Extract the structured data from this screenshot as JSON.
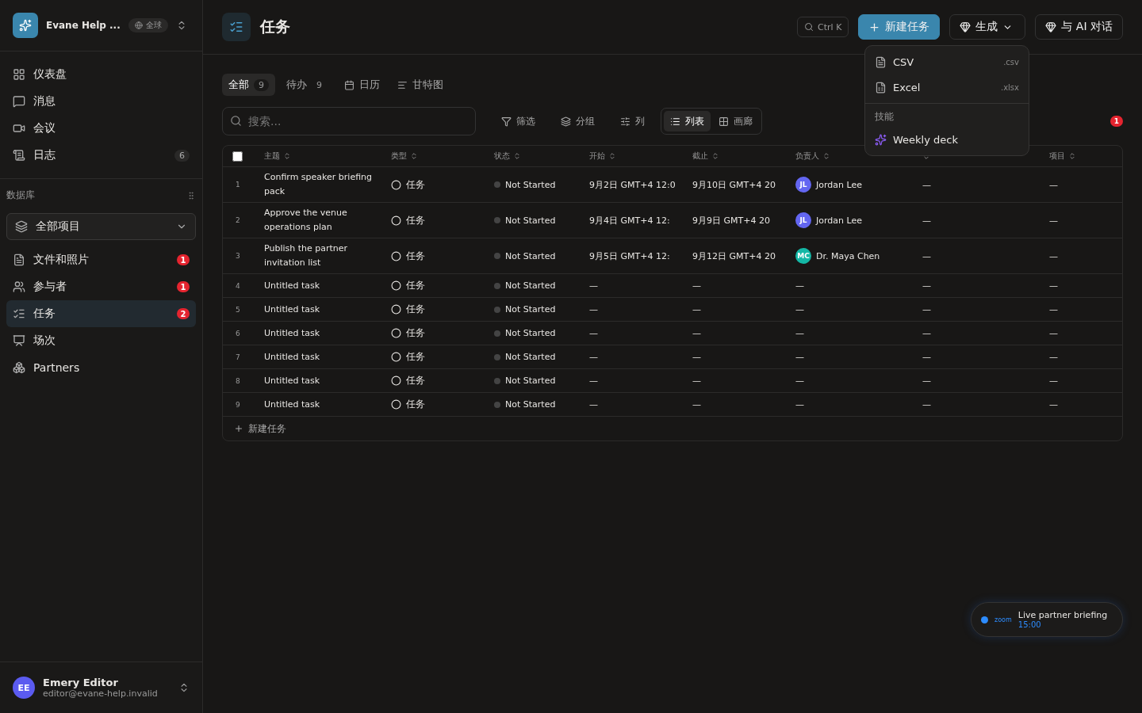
{
  "workspace": {
    "name": "Evane Help ...",
    "scope": "全球"
  },
  "nav": [
    {
      "label": "仪表盘"
    },
    {
      "label": "消息"
    },
    {
      "label": "会议"
    },
    {
      "label": "日志",
      "count": "6"
    }
  ],
  "database": {
    "title": "数据库",
    "selector": "全部项目",
    "items": [
      {
        "label": "文件和照片",
        "badge": "1",
        "selected": false
      },
      {
        "label": "参与者",
        "badge": "1",
        "selected": false
      },
      {
        "label": "任务",
        "badge": "2",
        "selected": true
      },
      {
        "label": "场次",
        "selected": false
      },
      {
        "label": "Partners",
        "selected": false
      }
    ]
  },
  "user": {
    "initials": "EE",
    "name": "Emery Editor",
    "email": "editor@evane-help.invalid"
  },
  "page": {
    "title": "任务",
    "search_hint": "Ctrl K",
    "new_button": "新建任务",
    "generate_button": "生成",
    "ai_button": "与 AI 对话"
  },
  "views": [
    {
      "label": "全部",
      "count": "9",
      "selected": true
    },
    {
      "label": "待办",
      "count": "9",
      "selected": false
    },
    {
      "label": "日历",
      "selected": false
    },
    {
      "label": "甘特图",
      "selected": false
    }
  ],
  "search": {
    "placeholder": "搜索..."
  },
  "tools": [
    {
      "label": "筛选"
    },
    {
      "label": "分组"
    },
    {
      "label": "列"
    }
  ],
  "layouts": [
    {
      "label": "列表",
      "selected": true
    },
    {
      "label": "画廊",
      "selected": false
    }
  ],
  "alert_count": "1",
  "table": {
    "select_all": {
      "checked": false
    },
    "columns": [
      {
        "label": "主题"
      },
      {
        "label": "类型"
      },
      {
        "label": "状态"
      },
      {
        "label": "开始"
      },
      {
        "label": "截止"
      },
      {
        "label": "负责人"
      },
      {},
      {
        "label": "项目"
      }
    ],
    "rows": [
      {
        "num": "1",
        "subject": "Confirm speaker briefing pack",
        "type": "任务",
        "status": "Not Started",
        "start": "9月2日 GMT+4 12:0",
        "due": "9月10日 GMT+4 20",
        "assignee": {
          "initials": "JL",
          "name": "Jordan Lee",
          "color": "#6366f1"
        },
        "progress": "—",
        "project": "—"
      },
      {
        "num": "2",
        "subject": "Approve the venue operations plan",
        "type": "任务",
        "status": "Not Started",
        "start": "9月4日 GMT+4 12:",
        "due": "9月9日 GMT+4 20",
        "assignee": {
          "initials": "JL",
          "name": "Jordan Lee",
          "color": "#6366f1"
        },
        "progress": "—",
        "project": "—"
      },
      {
        "num": "3",
        "subject": "Publish the partner invitation list",
        "type": "任务",
        "status": "Not Started",
        "start": "9月5日 GMT+4 12:",
        "due": "9月12日 GMT+4 20",
        "assignee": {
          "initials": "MC",
          "name": "Dr. Maya Chen",
          "color": "#14b8a6"
        },
        "progress": "—",
        "project": "—"
      },
      {
        "num": "4",
        "subject": "Untitled task",
        "type": "任务",
        "status": "Not Started",
        "start": "—",
        "due": "—",
        "assignee_text": "—",
        "progress": "—",
        "project": "—"
      },
      {
        "num": "5",
        "subject": "Untitled task",
        "type": "任务",
        "status": "Not Started",
        "start": "—",
        "due": "—",
        "assignee_text": "—",
        "progress": "—",
        "project": "—"
      },
      {
        "num": "6",
        "subject": "Untitled task",
        "type": "任务",
        "status": "Not Started",
        "start": "—",
        "due": "—",
        "assignee_text": "—",
        "progress": "—",
        "project": "—"
      },
      {
        "num": "7",
        "subject": "Untitled task",
        "type": "任务",
        "status": "Not Started",
        "start": "—",
        "due": "—",
        "assignee_text": "—",
        "progress": "—",
        "project": "—"
      },
      {
        "num": "8",
        "subject": "Untitled task",
        "type": "任务",
        "status": "Not Started",
        "start": "—",
        "due": "—",
        "assignee_text": "—",
        "progress": "—",
        "project": "—"
      },
      {
        "num": "9",
        "subject": "Untitled task",
        "type": "任务",
        "status": "Not Started",
        "start": "—",
        "due": "—",
        "assignee_text": "—",
        "progress": "—",
        "project": "—"
      }
    ],
    "add_row": "新建任务"
  },
  "menu": {
    "exports": [
      {
        "label": "CSV",
        "ext": ".csv"
      },
      {
        "label": "Excel",
        "ext": ".xlsx"
      }
    ],
    "section": "技能",
    "skills": [
      "Weekly deck"
    ]
  },
  "meeting": {
    "logo": "zoom",
    "title": "Live partner briefing",
    "time": "15:00"
  }
}
